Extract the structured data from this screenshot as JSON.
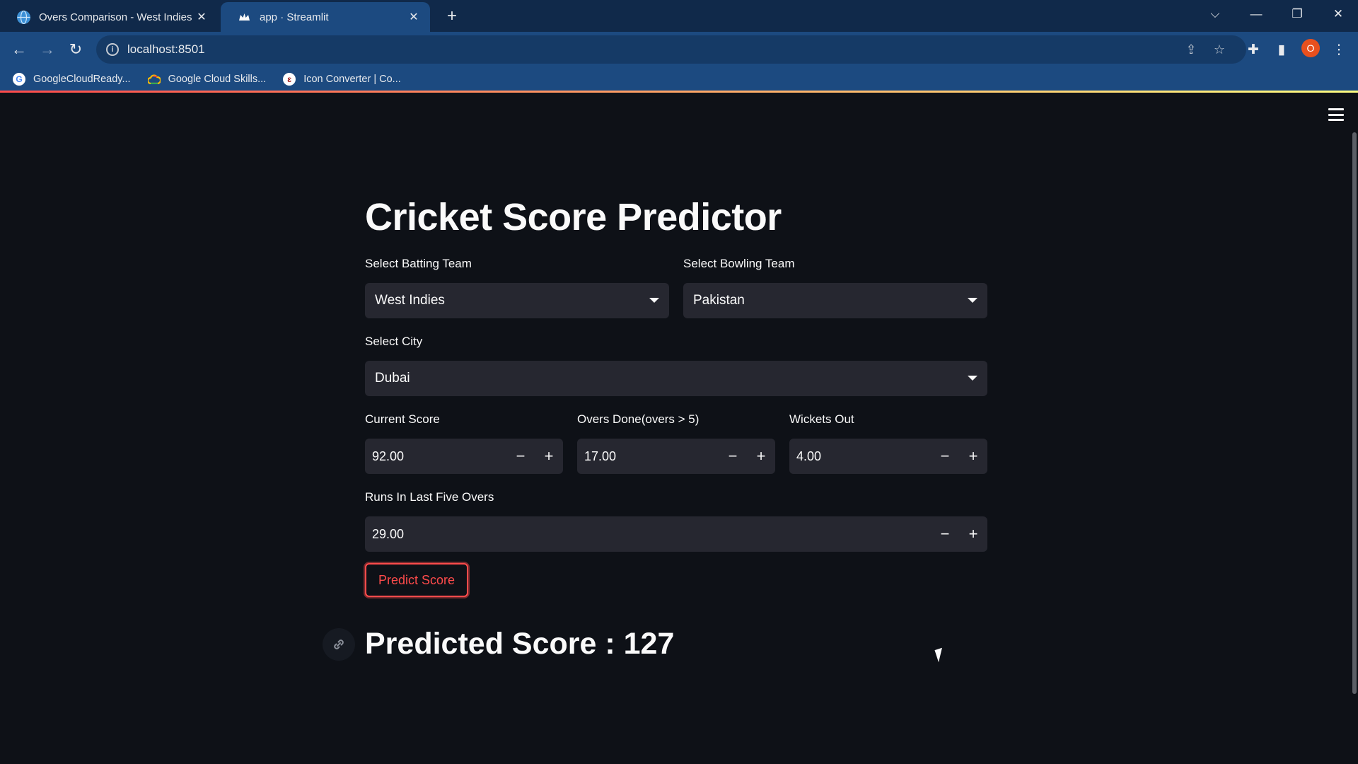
{
  "browser": {
    "tabs": [
      {
        "title": "Overs Comparison - West Indies",
        "favicon": "globe-icon",
        "active": false
      },
      {
        "title": "app · Streamlit",
        "favicon": "streamlit-crown-icon",
        "active": true
      }
    ],
    "url": "localhost:8501",
    "bookmarks": [
      {
        "label": "GoogleCloudReady...",
        "icon": "google-g-icon"
      },
      {
        "label": "Google Cloud Skills...",
        "icon": "google-cloud-icon"
      },
      {
        "label": "Icon Converter | Co...",
        "icon": "icon-converter-icon"
      }
    ],
    "profile_initial": "O"
  },
  "app": {
    "title": "Cricket Score Predictor",
    "batting_team": {
      "label": "Select Batting Team",
      "value": "West Indies"
    },
    "bowling_team": {
      "label": "Select Bowling Team",
      "value": "Pakistan"
    },
    "city": {
      "label": "Select City",
      "value": "Dubai"
    },
    "current_score": {
      "label": "Current Score",
      "value": "92.00"
    },
    "overs_done": {
      "label": "Overs Done(overs > 5)",
      "value": "17.00"
    },
    "wickets_out": {
      "label": "Wickets Out",
      "value": "4.00"
    },
    "runs_last_five": {
      "label": "Runs In Last Five Overs",
      "value": "29.00"
    },
    "predict_button": "Predict Score",
    "result": "Predicted Score : 127",
    "stepper_minus": "−",
    "stepper_plus": "+"
  },
  "colors": {
    "accent": "#ff4b4b",
    "app_background": "#0e1117",
    "widget_background": "#262730",
    "browser_toolbar": "#1c4a80"
  }
}
